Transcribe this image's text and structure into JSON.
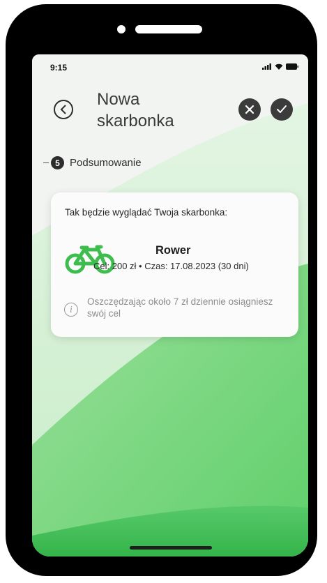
{
  "status_bar": {
    "time": "9:15"
  },
  "header": {
    "title_line1": "Nowa",
    "title_line2": "skarbonka"
  },
  "step": {
    "number": "5",
    "label": "Podsumowanie"
  },
  "summary_card": {
    "intro": "Tak będzie wyglądać Twoja skarbonka:",
    "goal_name": "Rower",
    "goal_details": "Cel: 200 zł • Czas: 17.08.2023 (30 dni)",
    "goal_icon": "bicycle-icon",
    "info_text": "Oszczędzając około 7 zł dziennie osiągniesz swój cel"
  },
  "colors": {
    "accent_green": "#3dbd4e",
    "light_green": "#cfeecf",
    "dark_button": "#3b3b3b"
  }
}
